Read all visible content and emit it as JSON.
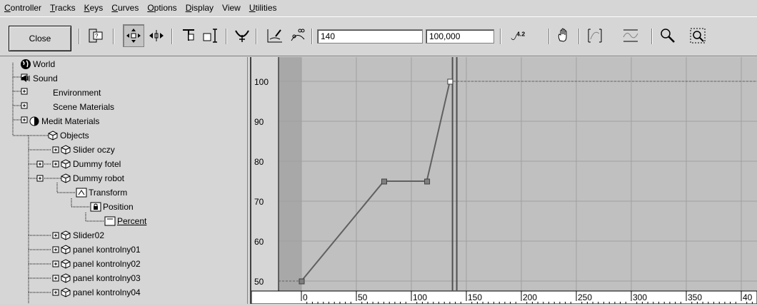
{
  "menu": [
    "Controller",
    "Tracks",
    "Keys",
    "Curves",
    "Options",
    "Display",
    "View",
    "Utilities"
  ],
  "toolbar": {
    "close_label": "Close",
    "frame_value": "140",
    "value_value": "100,000",
    "lock_icon_label": "4.2"
  },
  "tree": {
    "items": [
      {
        "label": "World",
        "icon": "world-icon"
      },
      {
        "label": "Sound",
        "icon": "sound-icon"
      },
      {
        "label": "Environment",
        "icon": ""
      },
      {
        "label": "Scene Materials",
        "icon": ""
      },
      {
        "label": "Medit Materials",
        "icon": "material-icon"
      },
      {
        "label": "Objects",
        "icon": "object-icon"
      },
      {
        "label": "Slider oczy",
        "icon": "object-icon"
      },
      {
        "label": "Dummy fotel",
        "icon": "object-icon"
      },
      {
        "label": "Dummy robot",
        "icon": "object-icon"
      },
      {
        "label": "Transform",
        "icon": "transform-icon"
      },
      {
        "label": "Position",
        "icon": "position-icon"
      },
      {
        "label": "Percent",
        "icon": "percent-icon"
      },
      {
        "label": "Slider02",
        "icon": "object-icon"
      },
      {
        "label": "panel kontrolny01",
        "icon": "object-icon"
      },
      {
        "label": "panel kontrolny02",
        "icon": "object-icon"
      },
      {
        "label": "panel kontrolny03",
        "icon": "object-icon"
      },
      {
        "label": "panel kontrolny04",
        "icon": "object-icon"
      }
    ]
  },
  "graph": {
    "y_ticks": [
      "100",
      "90",
      "80",
      "70",
      "60",
      "50"
    ],
    "x_ticks": [
      "0",
      "50",
      "100",
      "150",
      "200",
      "250",
      "300",
      "350",
      "40"
    ],
    "keys": [
      {
        "frame": 0,
        "value": 50
      },
      {
        "frame": 75,
        "value": 75
      },
      {
        "frame": 114,
        "value": 75
      },
      {
        "frame": 135,
        "value": 100
      }
    ],
    "current_frame": 140,
    "colors": {
      "background": "#c0c0c0",
      "out_of_range": "#a8a8a8",
      "curve": "#606060",
      "grid": "#a0a0a0"
    }
  }
}
